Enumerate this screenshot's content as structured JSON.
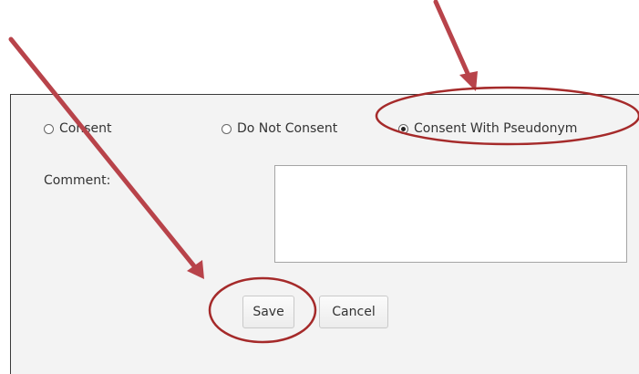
{
  "form": {
    "options": [
      {
        "label": "Consent",
        "selected": false
      },
      {
        "label": "Do Not Consent",
        "selected": false
      },
      {
        "label": "Consent With Pseudonym",
        "selected": true
      }
    ],
    "comment_label": "Comment:",
    "comment_value": "",
    "save_label": "Save",
    "cancel_label": "Cancel"
  },
  "annotations": {
    "color": "#b23a3a",
    "callouts": [
      "arrow-to-consent-with-pseudonym",
      "arrow-to-save-button"
    ]
  }
}
